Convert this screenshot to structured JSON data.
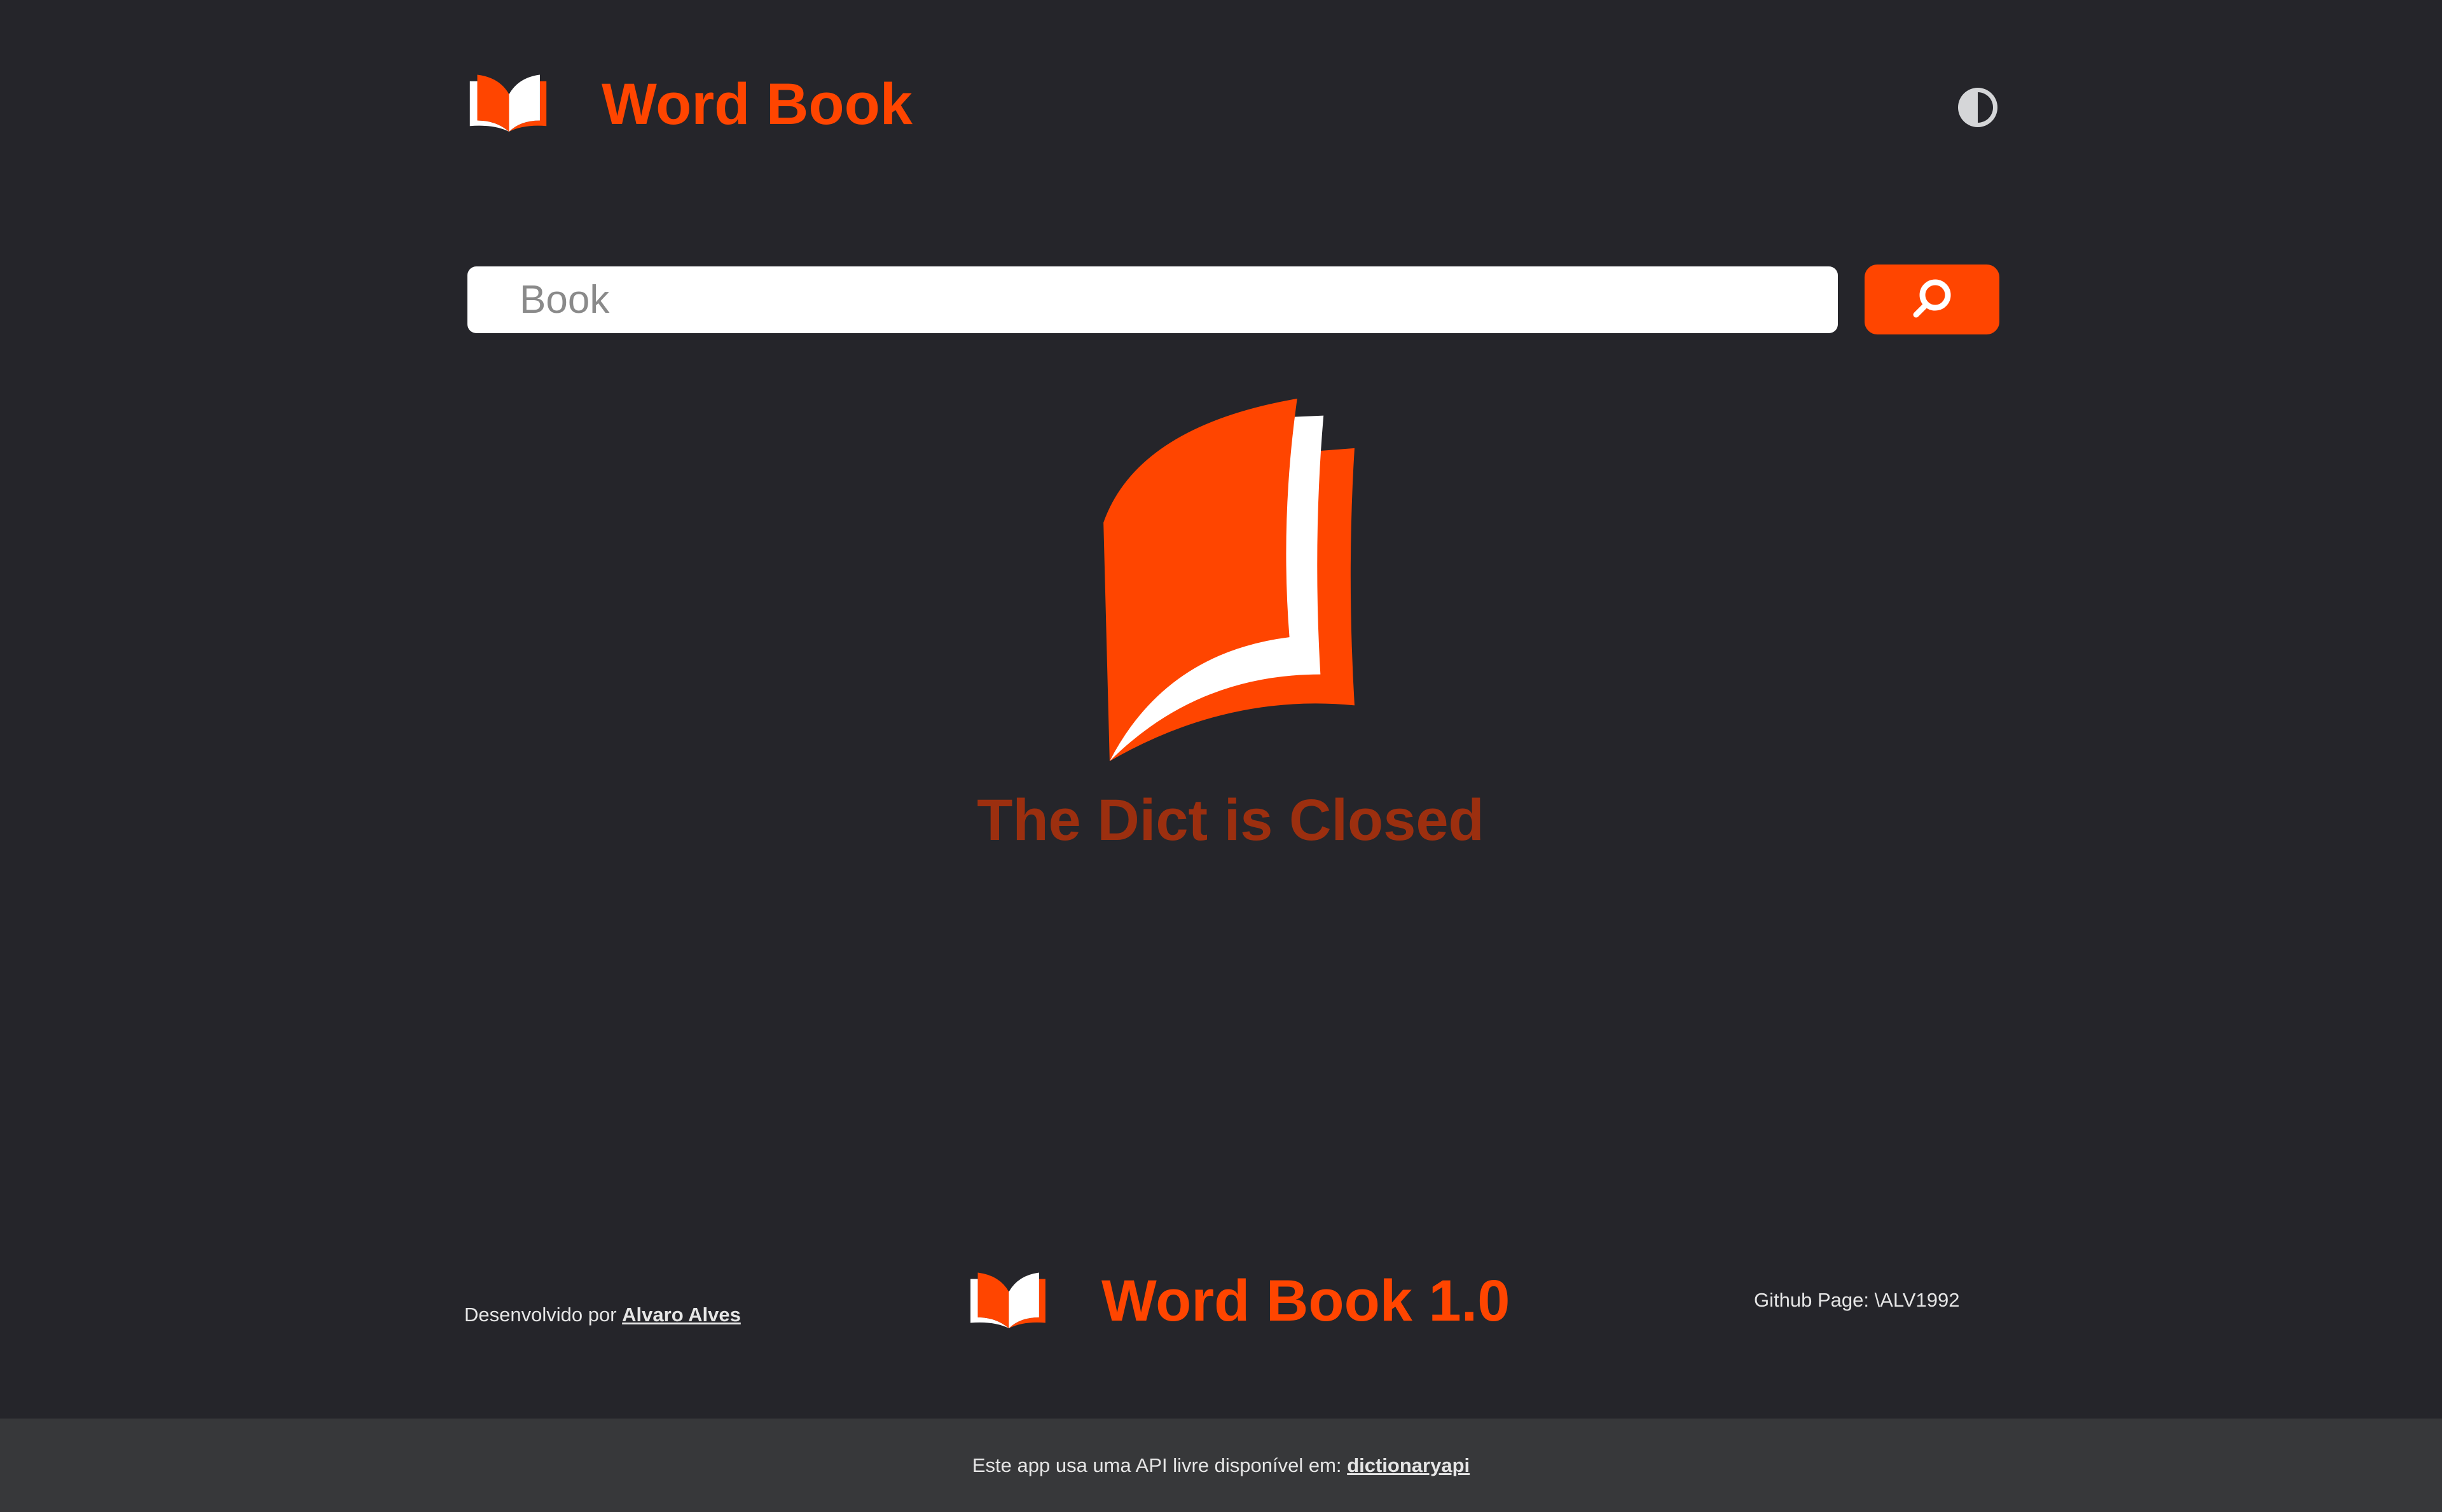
{
  "header": {
    "title": "Word Book",
    "logo_icon": "open-book-icon",
    "theme_icon": "contrast-icon"
  },
  "search": {
    "placeholder": "Book",
    "value": "",
    "button_icon": "search-icon"
  },
  "empty_state": {
    "icon": "book-icon",
    "message": "The Dict is Closed"
  },
  "footer": {
    "developed_by": "Desenvolvido por",
    "author": "Alvaro Alves",
    "brand": "Word Book 1.0",
    "github": "Github Page: \\ALV1992",
    "api_text": "Este app usa uma API livre disponível em:",
    "api_link": "dictionaryapi"
  },
  "colors": {
    "accent": "#ff4500",
    "background": "#25252a",
    "bottom_bar": "#37383a",
    "message": "#9c2f0f"
  }
}
